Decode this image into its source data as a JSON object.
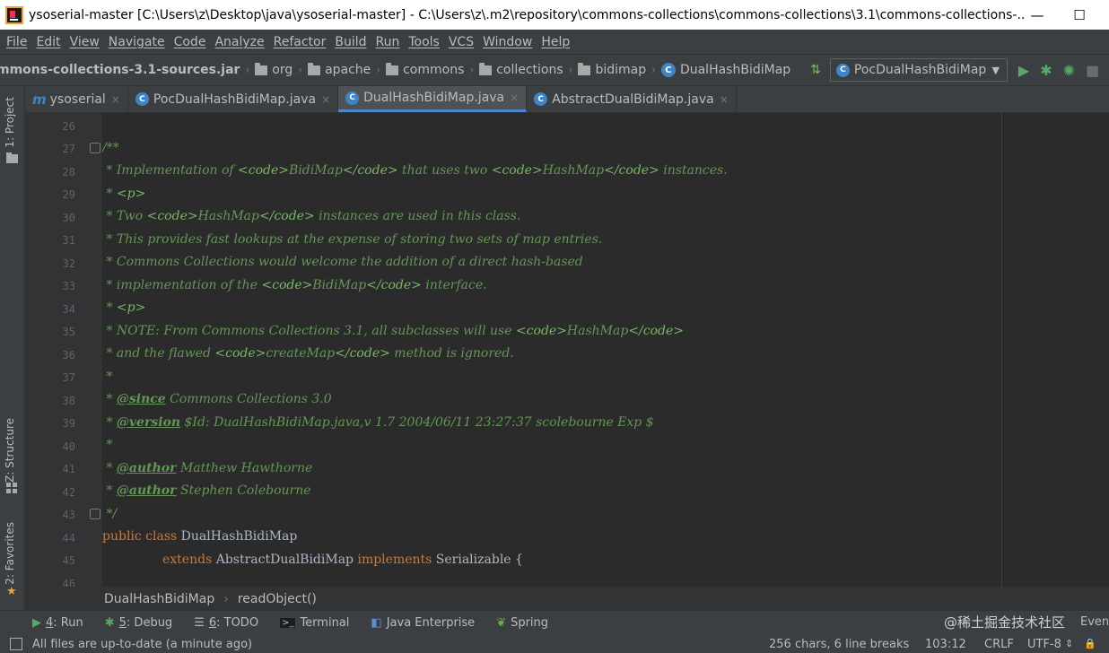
{
  "window": {
    "title": "ysoserial-master [C:\\Users\\z\\Desktop\\java\\ysoserial-master] - C:\\Users\\z\\.m2\\repository\\commons-collections\\commons-collections\\3.1\\commons-collections-...",
    "minimize": "—",
    "maximize": "☐"
  },
  "menu": [
    "File",
    "Edit",
    "View",
    "Navigate",
    "Code",
    "Analyze",
    "Refactor",
    "Build",
    "Run",
    "Tools",
    "VCS",
    "Window",
    "Help"
  ],
  "navbar": {
    "jar": "mmons-collections-3.1-sources.jar",
    "crumbs": [
      "org",
      "apache",
      "commons",
      "collections",
      "bidimap"
    ],
    "class_crumb": "DualHashBidiMap",
    "run_config": "PocDualHashBidiMap"
  },
  "tabs": [
    {
      "label": "ysoserial",
      "active": false
    },
    {
      "label": "PocDualHashBidiMap.java",
      "active": false
    },
    {
      "label": "DualHashBidiMap.java",
      "active": true
    },
    {
      "label": "AbstractDualBidiMap.java",
      "active": false
    }
  ],
  "left_tools": {
    "project": "1: Project",
    "structure": "Z: Structure",
    "favorites": "2: Favorites"
  },
  "editor": {
    "line_numbers": [
      "26",
      "27",
      "28",
      "29",
      "30",
      "31",
      "32",
      "33",
      "34",
      "35",
      "36",
      "37",
      "38",
      "39",
      "40",
      "41",
      "42",
      "43",
      "44",
      "45",
      "46"
    ],
    "lines": {
      "l27": "/**",
      "l28a": " * Implementation of ",
      "l28b": "<code>",
      "l28c": "BidiMap",
      "l28d": "</code>",
      "l28e": " that uses two ",
      "l28f": "<code>",
      "l28g": "HashMap",
      "l28h": "</code>",
      "l28i": " instances.",
      "l29a": " * ",
      "l29b": "<p>",
      "l30a": " * Two ",
      "l30b": "<code>",
      "l30c": "HashMap",
      "l30d": "</code>",
      "l30e": " instances are used in this class.",
      "l31": " * This provides fast lookups at the expense of storing two sets of map entries.",
      "l32": " * Commons Collections would welcome the addition of a direct hash-based",
      "l33a": " * implementation of the ",
      "l33b": "<code>",
      "l33c": "BidiMap",
      "l33d": "</code>",
      "l33e": " interface.",
      "l34a": " * ",
      "l34b": "<p>",
      "l35a": " * NOTE: From Commons Collections 3.1, all subclasses will use ",
      "l35b": "<code>",
      "l35c": "HashMap",
      "l35d": "</code>",
      "l36a": " * and the flawed ",
      "l36b": "<code>",
      "l36c": "createMap",
      "l36d": "</code>",
      "l36e": " method is ignored.",
      "l37": " *",
      "l38a": " * ",
      "l38b": "@since",
      "l38c": " Commons Collections 3.0",
      "l39a": " * ",
      "l39b": "@version",
      "l39c": " $Id: DualHashBidiMap.java,v 1.7 2004/06/11 23:27:37 scolebourne Exp $",
      "l40": " *",
      "l41a": " * ",
      "l41b": "@author",
      "l41c": " Matthew Hawthorne",
      "l42a": " * ",
      "l42b": "@author",
      "l42c": " Stephen Colebourne",
      "l43": " */",
      "l44a": "public class",
      "l44b": " DualHashBidiMap",
      "l45a": "extends",
      "l45b": " AbstractDualBidiMap ",
      "l45c": "implements",
      "l45d": " Serializable {"
    }
  },
  "structure_bar": {
    "class": "DualHashBidiMap",
    "method": "readObject()"
  },
  "bottom_tools": [
    {
      "prefix": "4",
      "label": ": Run"
    },
    {
      "prefix": "5",
      "label": ": Debug"
    },
    {
      "prefix": "6",
      "label": ": TODO"
    },
    {
      "prefix": "",
      "label": "Terminal"
    },
    {
      "prefix": "",
      "label": "Java Enterprise"
    },
    {
      "prefix": "",
      "label": "Spring"
    }
  ],
  "watermark": "@稀土掘金技术社区",
  "event_log": "Event Log",
  "status": {
    "message": "All files are up-to-date (a minute ago)",
    "chars": "256 chars, 6 line breaks",
    "position": "103:12",
    "line_sep": "CRLF",
    "encoding": "UTF-8",
    "lock": "🔒"
  }
}
